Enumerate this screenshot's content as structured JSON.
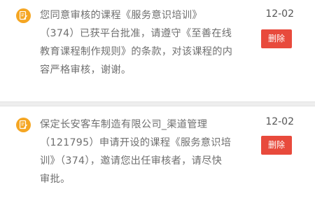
{
  "notifications": [
    {
      "icon": "document-edit-icon",
      "text": "您同意审核的课程《服务意识培训》\n（374）已获平台批准，请遵守《至善在线\n教育课程制作规则》的条款，对该课程的内\n容严格审核，谢谢。",
      "date": "12-02",
      "delete_label": "删除"
    },
    {
      "icon": "document-edit-icon",
      "text": "保定长安客车制造有限公司_渠道管理\n（121795）申请开设的课程《服务意识培\n训》（374），邀请您出任审核者，请尽快\n审批。",
      "date": "12-02",
      "delete_label": "删除"
    }
  ],
  "colors": {
    "icon_bg": "#f5a623",
    "delete_bg": "#e84a3c",
    "text": "#6f6f6f",
    "separator": "#eeeeee"
  }
}
